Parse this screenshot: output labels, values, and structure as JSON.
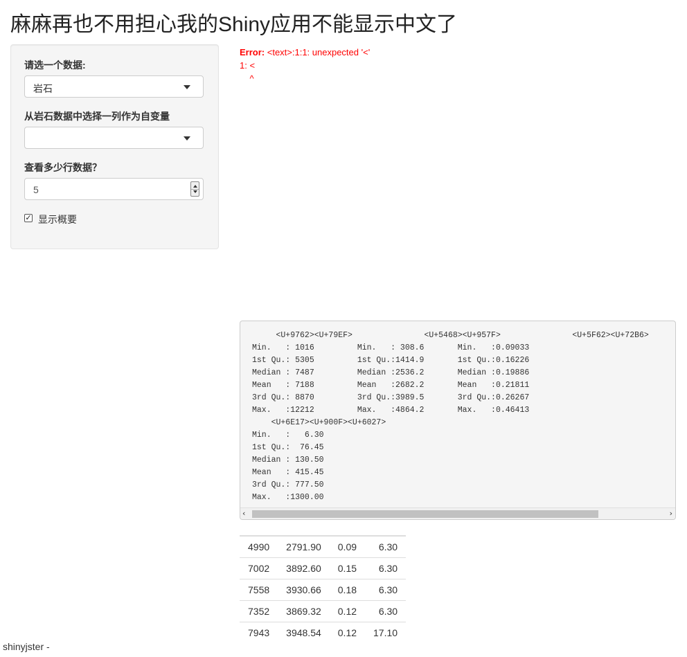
{
  "title": "麻麻再也不用担心我的Shiny应用不能显示中文了",
  "sidebar": {
    "dataset_label": "请选一个数据:",
    "dataset_value": "岩石",
    "column_label": "从岩石数据中选择一列作为自变量",
    "column_value": "",
    "rows_label": "查看多少行数据？",
    "rows_value": "5",
    "summary_checkbox_label": "显示概要",
    "summary_checked": true
  },
  "error": {
    "prefix": "Error:",
    "message": " <text>:1:1: unexpected '<'",
    "line2": "1: <",
    "line3": "    ^"
  },
  "summary_output": {
    "header1": "     <U+9762><U+79EF>               <U+5468><U+957F>               <U+5F62><U+72B6>",
    "rows1": [
      "Min.   : 1016         Min.   : 308.6       Min.   :0.09033",
      "1st Qu.: 5305         1st Qu.:1414.9       1st Qu.:0.16226",
      "Median : 7487         Median :2536.2       Median :0.19886",
      "Mean   : 7188         Mean   :2682.2       Mean   :0.21811",
      "3rd Qu.: 8870         3rd Qu.:3989.5       3rd Qu.:0.26267",
      "Max.   :12212         Max.   :4864.2       Max.   :0.46413"
    ],
    "header2": "    <U+6E17><U+900F><U+6027>",
    "rows2": [
      "Min.   :   6.30",
      "1st Qu.:  76.45",
      "Median : 130.50",
      "Mean   : 415.45",
      "3rd Qu.: 777.50",
      "Max.   :1300.00"
    ]
  },
  "table": {
    "rows": [
      [
        "4990",
        "2791.90",
        "0.09",
        "6.30"
      ],
      [
        "7002",
        "3892.60",
        "0.15",
        "6.30"
      ],
      [
        "7558",
        "3930.66",
        "0.18",
        "6.30"
      ],
      [
        "7352",
        "3869.32",
        "0.12",
        "6.30"
      ],
      [
        "7943",
        "3948.54",
        "0.12",
        "17.10"
      ]
    ]
  },
  "footer": "shinyjster -"
}
